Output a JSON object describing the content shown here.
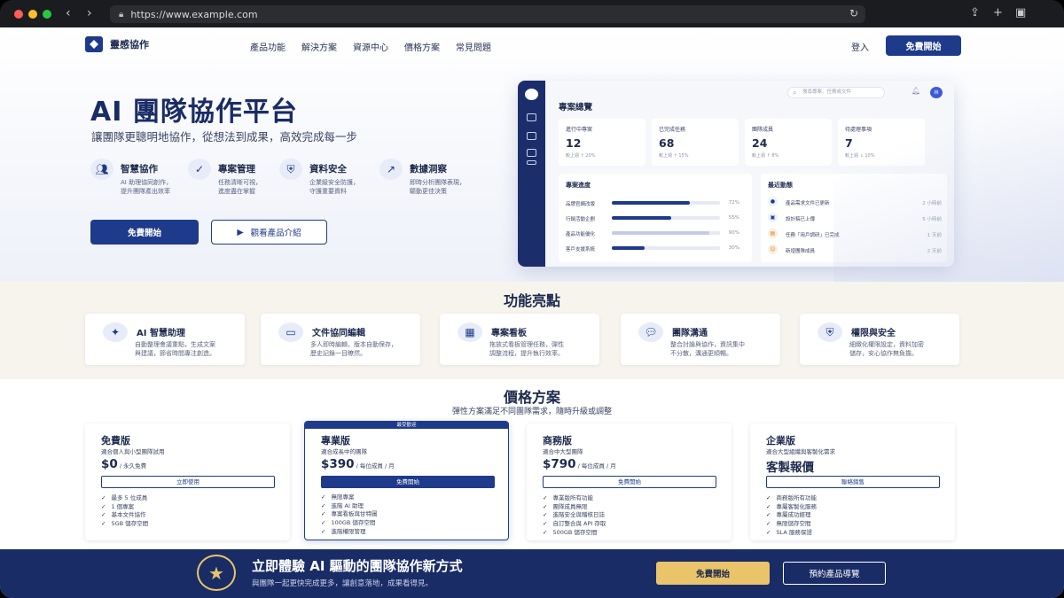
{
  "browser": {
    "url": "https://www.example.com",
    "traffic_lights": [
      "#ff5f57",
      "#febc2e",
      "#28c840"
    ]
  },
  "nav": {
    "brand": "靈感協作",
    "menu": [
      "產品功能",
      "解決方案",
      "資源中心",
      "價格方案",
      "常見問題"
    ],
    "login": "登入",
    "cta": "免費開始"
  },
  "hero": {
    "title": "AI 團隊協作平台",
    "subtitle": "讓團隊更聰明地協作，從想法到成果，高效完成每一步",
    "features": [
      {
        "icon": "team-icon",
        "title": "智慧協作",
        "desc1": "AI 助理協同創作，",
        "desc2": "提升團隊產出效率"
      },
      {
        "icon": "check-icon",
        "title": "專案管理",
        "desc1": "任務清晰可視，",
        "desc2": "進度盡在掌握"
      },
      {
        "icon": "shield-icon",
        "title": "資料安全",
        "desc1": "企業級安全防護，",
        "desc2": "守護重要資料"
      },
      {
        "icon": "chart-icon",
        "title": "數據洞察",
        "desc1": "即時分析團隊表現，",
        "desc2": "驅動更佳決策"
      }
    ],
    "primary_button": "免費開始",
    "secondary_button": "觀看產品介紹"
  },
  "dashboard": {
    "title": "專案總覽",
    "search_placeholder": "搜尋專案、任務或文件",
    "avatar": "林",
    "stats": [
      {
        "label": "進行中專案",
        "value": "12",
        "delta": "較上週 ↑ 20%"
      },
      {
        "label": "已完成任務",
        "value": "68",
        "delta": "較上週 ↑ 15%"
      },
      {
        "label": "團隊成員",
        "value": "24",
        "delta": "較上週 ↑ 8%"
      },
      {
        "label": "待處理事項",
        "value": "7",
        "delta": "較上週 ↓ 10%"
      }
    ],
    "progress_title": "專案進度",
    "progress": [
      {
        "name": "品牌官網改版",
        "value": 72,
        "label": "72%"
      },
      {
        "name": "行銷活動企劃",
        "value": 55,
        "label": "55%"
      },
      {
        "name": "產品功能優化",
        "value": 90,
        "label": "90%"
      },
      {
        "name": "客戶支援系統",
        "value": 30,
        "label": "30%"
      }
    ],
    "activity_title": "最近動態",
    "activity": [
      {
        "text": "產品需求文件已更新",
        "time": "2 小時前"
      },
      {
        "text": "設計稿已上傳",
        "time": "5 小時前"
      },
      {
        "text": "任務「用戶調研」已完成",
        "time": "1 天前"
      },
      {
        "text": "新增團隊成員",
        "time": "2 天前"
      }
    ]
  },
  "features_section": {
    "title": "功能亮點",
    "cards": [
      {
        "icon": "sparkle-icon",
        "title": "AI 智慧助理",
        "desc1": "自動整理會議重點，生成文案",
        "desc2": "與建議，節省時間專注創造。"
      },
      {
        "icon": "folder-icon",
        "title": "文件協同編輯",
        "desc1": "多人即時編輯，版本自動保存，",
        "desc2": "歷史記錄一目瞭然。"
      },
      {
        "icon": "kanban-icon",
        "title": "專案看板",
        "desc1": "拖放式看板管理任務，彈性",
        "desc2": "調整流程，提升執行效率。"
      },
      {
        "icon": "chat-icon",
        "title": "團隊溝通",
        "desc1": "整合討論與協作，資訊集中",
        "desc2": "不分散，溝通更順暢。"
      },
      {
        "icon": "shield-icon",
        "title": "權限與安全",
        "desc1": "細緻化權限設定，資料加密",
        "desc2": "儲存，安心協作無負擔。"
      }
    ]
  },
  "pricing": {
    "title": "價格方案",
    "subtitle": "彈性方案滿足不同團隊需求，隨時升級或調整",
    "plans": [
      {
        "name": "免費版",
        "desc": "適合個人與小型團隊試用",
        "price": "$0",
        "unit": " / 永久免費",
        "button": "立即使用",
        "items": [
          "最多 5 位成員",
          "1 個專案",
          "基本文件協作",
          "5GB 儲存空間"
        ]
      },
      {
        "name": "專業版",
        "badge": "最受歡迎",
        "desc": "適合成長中的團隊",
        "price": "$390",
        "unit": " / 每位成員 / 月",
        "button": "免費開始",
        "items": [
          "無限專案",
          "進階 AI 助理",
          "專案看板與甘特圖",
          "100GB 儲存空間",
          "進階權限管理"
        ]
      },
      {
        "name": "商務版",
        "desc": "適合中大型團隊",
        "price": "$790",
        "unit": " / 每位成員 / 月",
        "button": "免費開始",
        "items": [
          "專業版所有功能",
          "團隊成員無限",
          "進階安全與稽核日誌",
          "自訂整合與 API 存取",
          "500GB 儲存空間"
        ]
      },
      {
        "name": "企業版",
        "desc": "適合大型組織與客製化需求",
        "price": "客製報價",
        "unit": "",
        "button": "聯絡銷售",
        "items": [
          "商務版所有功能",
          "專屬客製化服務",
          "專屬成功經理",
          "無限儲存空間",
          "SLA 服務保證"
        ]
      }
    ]
  },
  "bottom_cta": {
    "title": "立即體驗 AI 驅動的團隊協作新方式",
    "subtitle": "與團隊一起更快完成更多，讓創意落地，成果看得見。",
    "primary": "免費開始",
    "secondary": "預約產品導覽"
  },
  "colors": {
    "brand": "#1e3a8a",
    "accent": "#e9c46a"
  }
}
